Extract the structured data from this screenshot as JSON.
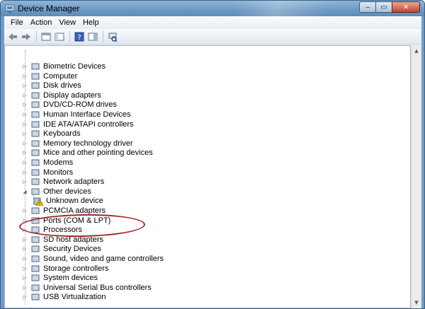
{
  "window": {
    "title": "Device Manager",
    "minimize_glyph": "‒",
    "maximize_glyph": "▭",
    "close_glyph": "✕"
  },
  "menu": {
    "items": [
      {
        "label": "File"
      },
      {
        "label": "Action"
      },
      {
        "label": "View"
      },
      {
        "label": "Help"
      }
    ]
  },
  "toolbar": {
    "buttons": [
      "back-icon",
      "forward-icon",
      "properties-view-icon",
      "console-tree-icon",
      "help-icon",
      "show-hide-icon",
      "scan-hardware-icon"
    ]
  },
  "tree": {
    "categories": [
      {
        "label": "Biometric Devices",
        "icon": "fingerprint-icon"
      },
      {
        "label": "Computer",
        "icon": "computer-icon"
      },
      {
        "label": "Disk drives",
        "icon": "disk-drive-icon"
      },
      {
        "label": "Display adapters",
        "icon": "display-adapter-icon"
      },
      {
        "label": "DVD/CD-ROM drives",
        "icon": "dvd-drive-icon"
      },
      {
        "label": "Human Interface Devices",
        "icon": "hid-icon"
      },
      {
        "label": "IDE ATA/ATAPI controllers",
        "icon": "ide-controller-icon"
      },
      {
        "label": "Keyboards",
        "icon": "keyboard-icon"
      },
      {
        "label": "Memory technology driver",
        "icon": "memory-icon"
      },
      {
        "label": "Mice and other pointing devices",
        "icon": "mouse-icon"
      },
      {
        "label": "Modems",
        "icon": "modem-icon"
      },
      {
        "label": "Monitors",
        "icon": "monitor-icon"
      },
      {
        "label": "Network adapters",
        "icon": "network-adapter-icon"
      },
      {
        "label": "Other devices",
        "icon": "other-devices-icon",
        "expanded": true
      },
      {
        "label": "Unknown device",
        "icon": "unknown-device-warning-icon",
        "child": true
      },
      {
        "label": "PCMCIA adapters",
        "icon": "pcmcia-icon"
      },
      {
        "label": "Ports (COM & LPT)",
        "icon": "port-icon"
      },
      {
        "label": "Processors",
        "icon": "processor-icon"
      },
      {
        "label": "SD host adapters",
        "icon": "sd-host-icon"
      },
      {
        "label": "Security Devices",
        "icon": "security-key-icon"
      },
      {
        "label": "Sound, video and game controllers",
        "icon": "sound-icon"
      },
      {
        "label": "Storage controllers",
        "icon": "storage-controller-icon"
      },
      {
        "label": "System devices",
        "icon": "system-devices-icon"
      },
      {
        "label": "Universal Serial Bus controllers",
        "icon": "usb-icon"
      },
      {
        "label": "USB Virtualization",
        "icon": "usb-virtualization-icon"
      }
    ]
  },
  "colors": {
    "highlight_ring": "#a0282e",
    "titlebar": "#6f9cc6"
  }
}
